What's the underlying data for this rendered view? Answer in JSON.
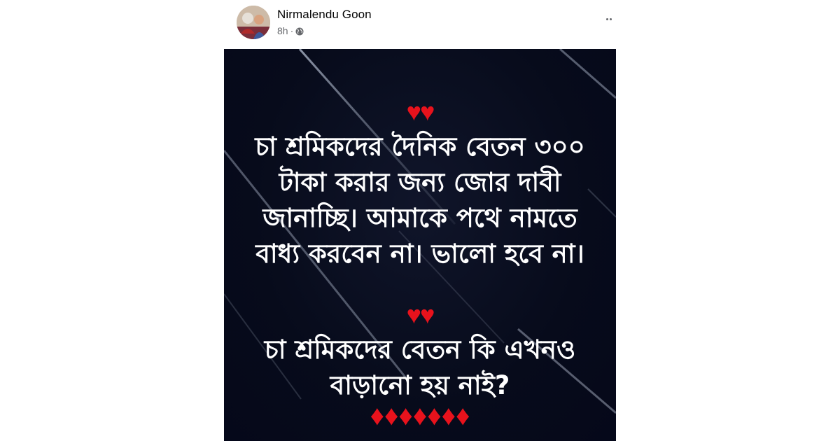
{
  "post": {
    "author": "Nirmalendu Goon",
    "time": "8h",
    "separator": "·",
    "privacy_icon": "globe-icon",
    "more_icon": "more-options-icon"
  },
  "image": {
    "hearts_top": "♥♥",
    "message_1": "চা শ্রমিকদের দৈনিক বেতন ৩০০ টাকা করার জন্য জোর দাবী জানাচ্ছি। আমাকে পথে নামতে বাধ্য করবেন না। ভালো হবে না।",
    "hearts_middle": "♥♥",
    "message_2": "চা শ্রমিকদের বেতন কি এখনও বাড়ানো হয় নাই?",
    "diamonds": "♦♦♦♦♦♦♦"
  },
  "colors": {
    "heart_red": "#e8121c",
    "card_background": "#070b1b",
    "text_white": "#ffffff",
    "meta_gray": "#65676b"
  }
}
